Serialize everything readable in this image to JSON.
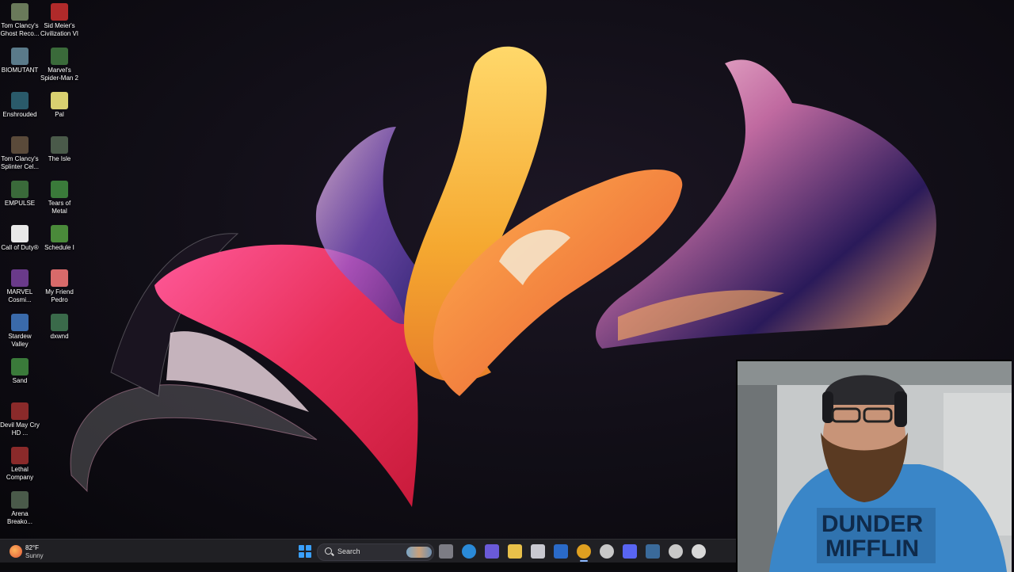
{
  "desktop_icons": [
    {
      "label": "Tom Clancy's Ghost Reco...",
      "icon": "ghost-recon-icon",
      "color": "#6a7a5a"
    },
    {
      "label": "Sid Meier's Civilization VI",
      "icon": "civilization-icon",
      "color": "#b02a2a"
    },
    {
      "label": "BIOMUTANT",
      "icon": "biomutant-icon",
      "color": "#5a7a8a"
    },
    {
      "label": "Marvel's Spider-Man 2",
      "icon": "spiderman-icon",
      "color": "#3a6a3a"
    },
    {
      "label": "Enshrouded",
      "icon": "enshrouded-icon",
      "color": "#2a5a6a"
    },
    {
      "label": "Pal",
      "icon": "palworld-icon",
      "color": "#d8d070"
    },
    {
      "label": "Tom Clancy's Splinter Cel...",
      "icon": "splinter-cell-icon",
      "color": "#5a4a3a"
    },
    {
      "label": "The Isle",
      "icon": "the-isle-icon",
      "color": "#4a5a4a"
    },
    {
      "label": "EMPULSE",
      "icon": "empulse-icon",
      "color": "#3a6a3a"
    },
    {
      "label": "Tears of Metal",
      "icon": "tears-of-metal-icon",
      "color": "#3a7a3a"
    },
    {
      "label": "Call of Duty®",
      "icon": "file-icon",
      "color": "#e8e8e8"
    },
    {
      "label": "Schedule I",
      "icon": "schedule-i-icon",
      "color": "#4a8a3a"
    },
    {
      "label": "MARVEL Cosmi...",
      "icon": "marvel-cosmic-icon",
      "color": "#6a3a8a"
    },
    {
      "label": "My Friend Pedro",
      "icon": "pedro-icon",
      "color": "#d86a6a"
    },
    {
      "label": "Stardew Valley",
      "icon": "stardew-icon",
      "color": "#3a6aaa"
    },
    {
      "label": "dxwnd",
      "icon": "dxwnd-icon",
      "color": "#3a6a4a"
    },
    {
      "label": "Sand",
      "icon": "sand-icon",
      "color": "#3a7a3a"
    },
    {
      "label": "",
      "icon": "blank",
      "color": "transparent"
    },
    {
      "label": "Devil May Cry HD ...",
      "icon": "devil-may-cry-icon",
      "color": "#8a2a2a"
    },
    {
      "label": "",
      "icon": "blank",
      "color": "transparent"
    },
    {
      "label": "Lethal Company",
      "icon": "lethal-company-icon",
      "color": "#8a2a2a"
    },
    {
      "label": "",
      "icon": "blank",
      "color": "transparent"
    },
    {
      "label": "Arena Breako...",
      "icon": "arena-breakout-icon",
      "color": "#4a5a4a"
    }
  ],
  "taskbar": {
    "weather": {
      "temp": "82°F",
      "condition": "Sunny"
    },
    "search_placeholder": "Search",
    "pinned": [
      {
        "name": "file-explorer-icon",
        "color": "#7c7c84"
      },
      {
        "name": "edge-icon",
        "color": "#2a8ad8"
      },
      {
        "name": "copilot-icon",
        "color": "#6a5ad8"
      },
      {
        "name": "folder-icon",
        "color": "#e8c04a"
      },
      {
        "name": "store-icon",
        "color": "#c8c8d0"
      },
      {
        "name": "outlook-icon",
        "color": "#2a6ac8"
      },
      {
        "name": "chrome-icon",
        "color": "#e0a020"
      },
      {
        "name": "steelseries-icon",
        "color": "#c8c8c8"
      },
      {
        "name": "discord-icon",
        "color": "#5865f2"
      },
      {
        "name": "steam-icon",
        "color": "#3a6a9a"
      },
      {
        "name": "chrome-dev-icon",
        "color": "#c8c8c8"
      },
      {
        "name": "obs-icon",
        "color": "#d8d8d8"
      }
    ]
  },
  "colors": {
    "accent": "#3aa0ff",
    "taskbar": "#202024"
  }
}
